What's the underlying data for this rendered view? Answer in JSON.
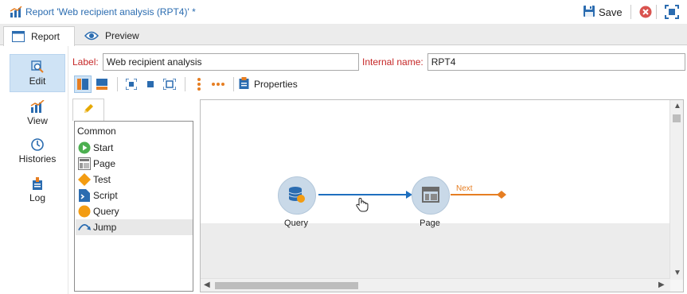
{
  "window": {
    "title": "Report 'Web recipient analysis (RPT4)' *",
    "save_label": "Save",
    "icons": {
      "app": "report-chart-icon",
      "save": "floppy-disk-icon",
      "close": "close-circle-icon",
      "fullscreen": "fullscreen-icon"
    },
    "accent_color": "#2b6cb0",
    "close_color": "#d9534f"
  },
  "tabs": [
    {
      "label": "Report",
      "icon": "form-icon",
      "active": true
    },
    {
      "label": "Preview",
      "icon": "eye-icon",
      "active": false
    }
  ],
  "nav": [
    {
      "label": "Edit",
      "icon": "magnifier-edit-icon",
      "active": true
    },
    {
      "label": "View",
      "icon": "chart-icon",
      "active": false
    },
    {
      "label": "Histories",
      "icon": "clock-icon",
      "active": false
    },
    {
      "label": "Log",
      "icon": "log-icon",
      "active": false
    }
  ],
  "fields": {
    "label_caption": "Label:",
    "label_value": "Web recipient analysis",
    "internal_caption": "Internal name:",
    "internal_value": "RPT4",
    "caption_color": "#c62828"
  },
  "toolbar": {
    "properties_label": "Properties"
  },
  "palette": {
    "group": "Common",
    "items": [
      {
        "label": "Start",
        "icon": "start-play-icon",
        "selected": false
      },
      {
        "label": "Page",
        "icon": "page-layout-icon",
        "selected": false
      },
      {
        "label": "Test",
        "icon": "test-diamond-icon",
        "selected": false
      },
      {
        "label": "Script",
        "icon": "script-file-icon",
        "selected": false
      },
      {
        "label": "Query",
        "icon": "query-circle-icon",
        "selected": false
      },
      {
        "label": "Jump",
        "icon": "jump-arrow-icon",
        "selected": true
      }
    ]
  },
  "diagram": {
    "nodes": [
      {
        "label": "Query",
        "icon": "database-icon"
      },
      {
        "label": "Page",
        "icon": "page-layout-icon"
      }
    ],
    "transition_label": "Next",
    "link_color": "#1e6fbf",
    "next_color": "#e67e22"
  }
}
